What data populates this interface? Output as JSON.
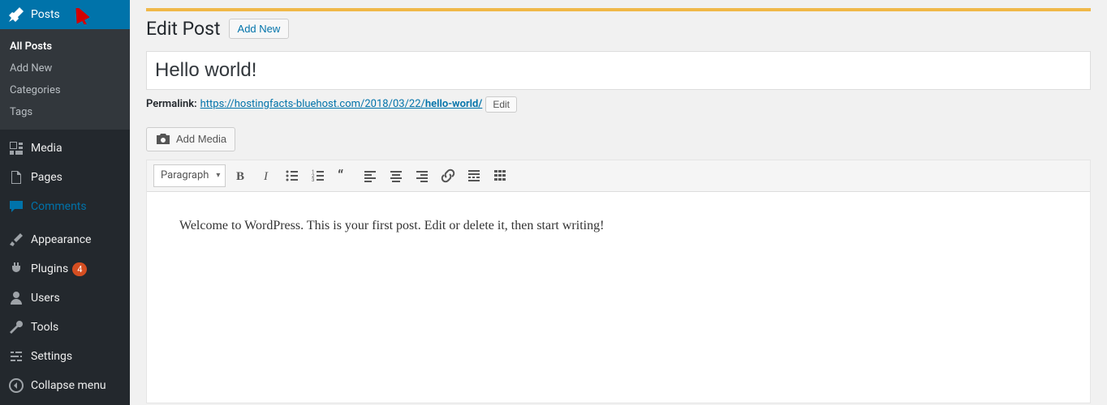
{
  "sidebar": {
    "posts": {
      "label": "Posts"
    },
    "submenu": {
      "all_posts": "All Posts",
      "add_new": "Add New",
      "categories": "Categories",
      "tags": "Tags"
    },
    "media": "Media",
    "pages": "Pages",
    "comments": "Comments",
    "appearance": "Appearance",
    "plugins": {
      "label": "Plugins",
      "badge": "4"
    },
    "users": "Users",
    "tools": "Tools",
    "settings": "Settings",
    "collapse": "Collapse menu"
  },
  "page": {
    "heading": "Edit Post",
    "add_new": "Add New",
    "title_value": "Hello world!",
    "permalink_label": "Permalink:",
    "permalink_base": "https://hostingfacts-bluehost.com/2018/03/22/",
    "permalink_slug": "hello-world/",
    "edit_btn": "Edit",
    "add_media": "Add Media",
    "format_dropdown": "Paragraph",
    "body_text": "Welcome to WordPress. This is your first post. Edit or delete it, then start writing!"
  }
}
